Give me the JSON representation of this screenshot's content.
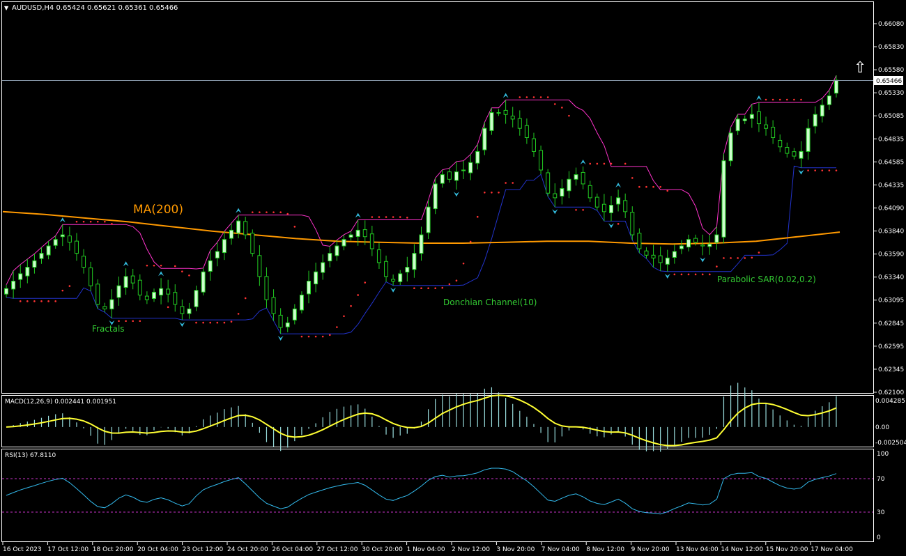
{
  "symbol_header": {
    "text": "AUDUSD,H4  0.65424 0.65621 0.65361 0.65466"
  },
  "price_axis": {
    "ticks": [
      "0.66080",
      "0.65830",
      "0.65580",
      "0.65330",
      "0.65085",
      "0.64835",
      "0.64585",
      "0.64335",
      "0.64090",
      "0.63840",
      "0.63590",
      "0.63340",
      "0.63095",
      "0.62845",
      "0.62595",
      "0.62345",
      "0.62100"
    ],
    "current_price_label": "0.65466"
  },
  "time_axis": {
    "ticks": [
      "16 Oct 2023",
      "17 Oct 12:00",
      "18 Oct 20:00",
      "20 Oct 04:00",
      "23 Oct 12:00",
      "24 Oct 20:00",
      "26 Oct 04:00",
      "27 Oct 12:00",
      "30 Oct 20:00",
      "1 Nov 04:00",
      "2 Nov 12:00",
      "3 Nov 20:00",
      "7 Nov 04:00",
      "8 Nov 12:00",
      "9 Nov 20:00",
      "13 Nov 04:00",
      "14 Nov 12:00",
      "15 Nov 20:00",
      "17 Nov 04:00"
    ]
  },
  "annotations": {
    "ma": "MA(200)",
    "fractals": "Fractals",
    "donchian": "Donchian Channel(10)",
    "sar": "Parabolic SAR(0.02,0.2)"
  },
  "macd_panel": {
    "header": "MACD(12,26,9) 0.002441 0.001951",
    "ticks": [
      "0.004285",
      "0.00",
      "-0.002504"
    ]
  },
  "rsi_panel": {
    "header": "RSI(13) 67.8110",
    "ticks": [
      "100",
      "70",
      "30",
      "0"
    ]
  },
  "colors": {
    "background": "#000000",
    "bull_candle": "#ccffcc",
    "candle_outline": "#22cc22",
    "ma": "#ff9900",
    "donchian_upper": "#ff33cc",
    "donchian_lower": "#2233cc",
    "sar": "#ff3333",
    "fractal": "#33bbdd",
    "macd_hist": "#99dddd",
    "macd_signal": "#ffff33",
    "rsi": "#33bbee",
    "rsi_levels": "#cc33cc",
    "annotation_green": "#33cc33"
  },
  "chart_data": {
    "type": "candlestick",
    "symbol": "AUDUSD",
    "timeframe": "H4",
    "last_bar": {
      "open": 0.65424,
      "high": 0.65621,
      "low": 0.65361,
      "close": 0.65466
    },
    "ylim": [
      0.621,
      0.6625
    ],
    "x_labels": [
      "16 Oct 2023",
      "17 Oct 12:00",
      "18 Oct 20:00",
      "20 Oct 04:00",
      "23 Oct 12:00",
      "24 Oct 20:00",
      "26 Oct 04:00",
      "27 Oct 12:00",
      "30 Oct 20:00",
      "1 Nov 04:00",
      "2 Nov 12:00",
      "3 Nov 20:00",
      "7 Nov 04:00",
      "8 Nov 12:00",
      "9 Nov 20:00",
      "13 Nov 04:00",
      "14 Nov 12:00",
      "15 Nov 20:00",
      "17 Nov 04:00"
    ],
    "close_path": [
      0.6322,
      0.633,
      0.6338,
      0.6345,
      0.6352,
      0.636,
      0.6368,
      0.6375,
      0.638,
      0.6372,
      0.636,
      0.6345,
      0.6325,
      0.6305,
      0.63,
      0.631,
      0.6325,
      0.6335,
      0.6328,
      0.6315,
      0.631,
      0.6318,
      0.6322,
      0.6316,
      0.6305,
      0.6295,
      0.63,
      0.632,
      0.634,
      0.6352,
      0.6362,
      0.6375,
      0.6385,
      0.6395,
      0.638,
      0.636,
      0.6335,
      0.631,
      0.6295,
      0.628,
      0.6285,
      0.63,
      0.6315,
      0.633,
      0.634,
      0.635,
      0.636,
      0.6368,
      0.6375,
      0.638,
      0.6385,
      0.6378,
      0.6365,
      0.635,
      0.6335,
      0.633,
      0.6338,
      0.6345,
      0.636,
      0.638,
      0.641,
      0.6435,
      0.6445,
      0.644,
      0.6448,
      0.645,
      0.6458,
      0.647,
      0.6495,
      0.6512,
      0.6512,
      0.651,
      0.6505,
      0.6495,
      0.6485,
      0.647,
      0.645,
      0.6425,
      0.642,
      0.643,
      0.644,
      0.6445,
      0.6435,
      0.642,
      0.641,
      0.6405,
      0.6412,
      0.642,
      0.6405,
      0.638,
      0.6365,
      0.6358,
      0.6355,
      0.635,
      0.6355,
      0.6362,
      0.6368,
      0.6375,
      0.6372,
      0.6368,
      0.637,
      0.638,
      0.646,
      0.649,
      0.6505,
      0.6505,
      0.651,
      0.65,
      0.6495,
      0.6485,
      0.6475,
      0.6468,
      0.6465,
      0.647,
      0.6495,
      0.651,
      0.652,
      0.653,
      0.6547
    ],
    "ma200_path": [
      0.6405,
      0.6402,
      0.6398,
      0.6394,
      0.6389,
      0.6384,
      0.638,
      0.6376,
      0.6373,
      0.6372,
      0.6371,
      0.6371,
      0.6372,
      0.6373,
      0.6373,
      0.6371,
      0.637,
      0.6371,
      0.6373,
      0.6378,
      0.6383
    ],
    "macd": {
      "value": 0.002441,
      "signal": 0.001951,
      "ylim": [
        -0.002504,
        0.004285
      ]
    },
    "rsi": {
      "value": 67.811,
      "levels": [
        30,
        70
      ],
      "ylim": [
        0,
        100
      ]
    }
  }
}
